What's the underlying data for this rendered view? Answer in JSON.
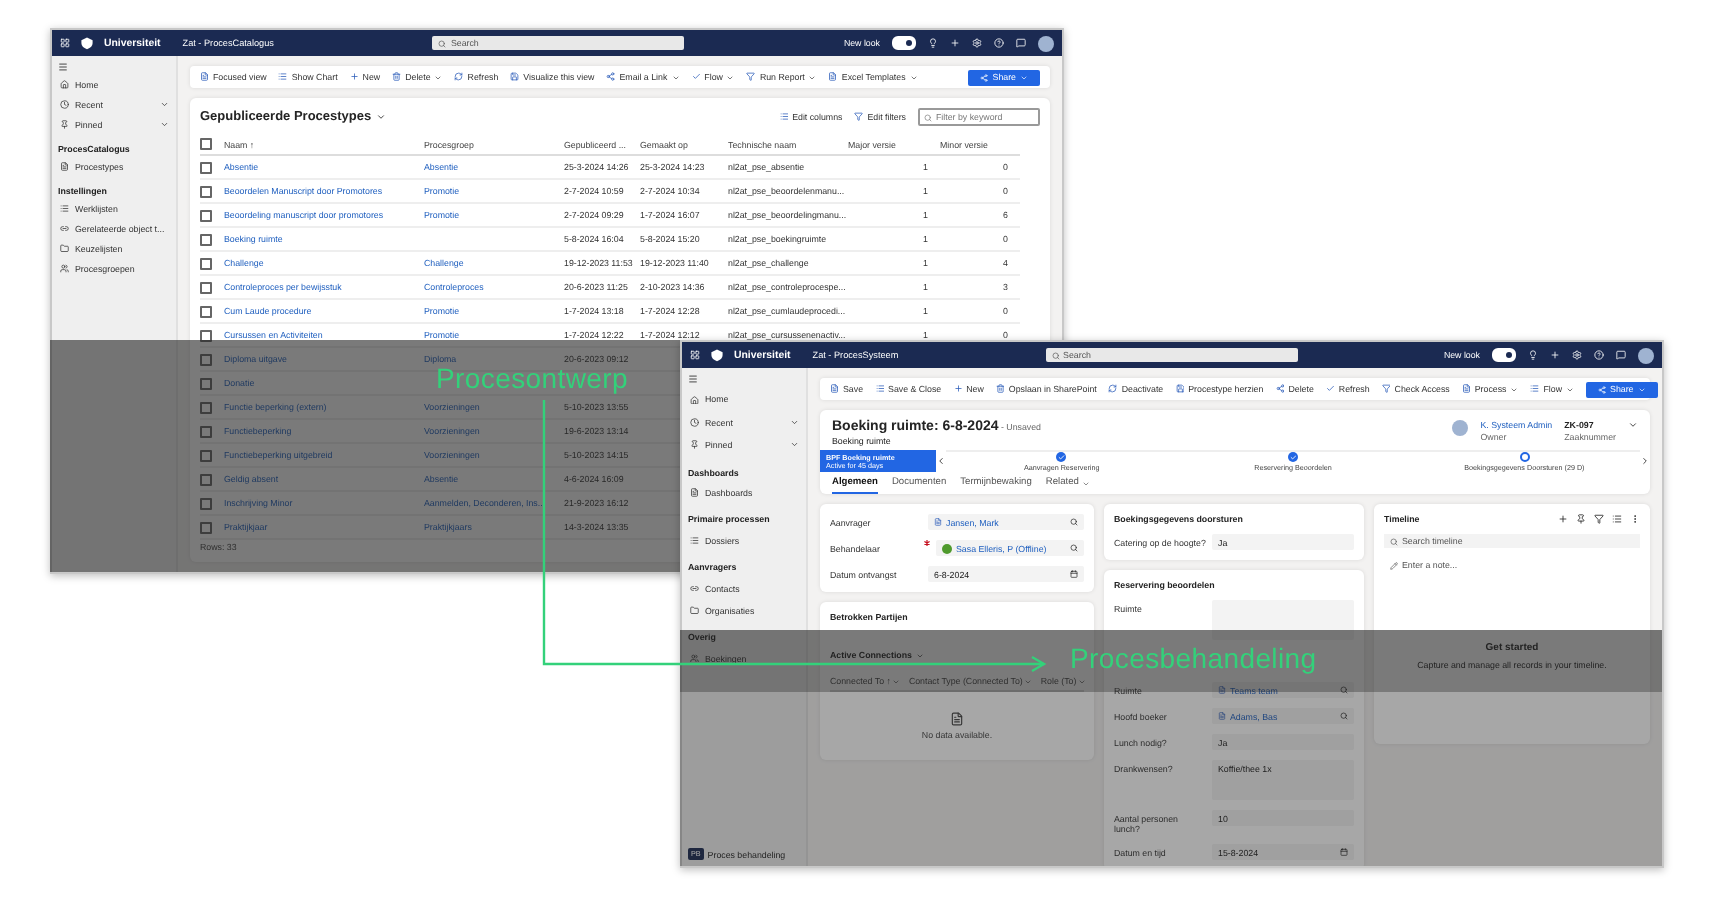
{
  "catalog_window": {
    "nav": {
      "app_title": "Zat - ProcesCatalogus",
      "brand": "Universiteit",
      "search_placeholder": "Search",
      "new_look_label": "New look",
      "new_look_on": true
    },
    "sidebar": [
      {
        "kind": "nav",
        "label": "Home"
      },
      {
        "kind": "group",
        "label": "Recent"
      },
      {
        "kind": "group",
        "label": "Pinned"
      },
      {
        "kind": "section",
        "label": "ProcesCatalogus"
      },
      {
        "kind": "item",
        "label": "Procestypes"
      },
      {
        "kind": "section",
        "label": "Instellingen"
      },
      {
        "kind": "item",
        "label": "Werklijsten"
      },
      {
        "kind": "item",
        "label": "Gerelateerde object t..."
      },
      {
        "kind": "item",
        "label": "Keuzelijsten"
      },
      {
        "kind": "item",
        "label": "Procesgroepen"
      }
    ],
    "commands": [
      {
        "label": "Focused view",
        "menu": false
      },
      {
        "label": "Show Chart",
        "menu": false
      },
      {
        "label": "New",
        "menu": false
      },
      {
        "label": "Delete",
        "menu": true
      },
      {
        "label": "Refresh",
        "menu": false
      },
      {
        "label": "Visualize this view",
        "menu": false
      },
      {
        "label": "Email a Link",
        "menu": true
      },
      {
        "label": "Flow",
        "menu": true
      },
      {
        "label": "Run Report",
        "menu": true
      },
      {
        "label": "Excel Templates",
        "menu": true
      }
    ],
    "share": "Share",
    "view_title": "Gepubliceerde Procestypes",
    "view_actions": [
      "Edit columns",
      "Edit filters"
    ],
    "filter_placeholder": "Filter by keyword",
    "select_all_checked": false,
    "columns": [
      "Naam ↑",
      "Procesgroep",
      "Gepubliceerd ...",
      "Gemaakt op",
      "Technische naam",
      "Major versie",
      "Minor versie"
    ],
    "rows": [
      {
        "checked": false,
        "cells": [
          "Absentie",
          "Absentie",
          "25-3-2024 14:26",
          "25-3-2024 14:23",
          "nl2at_pse_absentie",
          "1",
          "0"
        ]
      },
      {
        "checked": false,
        "cells": [
          "Beoordelen Manuscript door Promotores",
          "Promotie",
          "2-7-2024 10:59",
          "2-7-2024 10:34",
          "nl2at_pse_beoordelenmanu...",
          "1",
          "0"
        ]
      },
      {
        "checked": false,
        "cells": [
          "Beoordeling manuscript door promotores",
          "Promotie",
          "2-7-2024 09:29",
          "1-7-2024 16:07",
          "nl2at_pse_beoordelingmanu...",
          "1",
          "6"
        ]
      },
      {
        "checked": false,
        "cells": [
          "Boeking ruimte",
          "",
          "5-8-2024 16:04",
          "5-8-2024 15:20",
          "nl2at_pse_boekingruimte",
          "1",
          "0"
        ]
      },
      {
        "checked": false,
        "cells": [
          "Challenge",
          "Challenge",
          "19-12-2023 11:53",
          "19-12-2023 11:40",
          "nl2at_pse_challenge",
          "1",
          "4"
        ]
      },
      {
        "checked": false,
        "cells": [
          "Controleproces per bewijsstuk",
          "Controleproces",
          "20-6-2023 11:25",
          "2-10-2023 14:36",
          "nl2at_pse_controleprocespe...",
          "1",
          "3"
        ]
      },
      {
        "checked": false,
        "cells": [
          "Cum Laude procedure",
          "Promotie",
          "1-7-2024 13:18",
          "1-7-2024 12:28",
          "nl2at_pse_cumlaudeprocedi...",
          "1",
          "0"
        ]
      },
      {
        "checked": false,
        "cells": [
          "Cursussen en Activiteiten",
          "Promotie",
          "1-7-2024 12:22",
          "1-7-2024 12:12",
          "nl2at_pse_cursussenenactiv...",
          "1",
          "0"
        ]
      },
      {
        "checked": false,
        "cells": [
          "Diploma uitgave",
          "Diploma",
          "20-6-2023 09:12"
        ]
      },
      {
        "checked": false,
        "cells": [
          "Donatie"
        ]
      },
      {
        "checked": false,
        "cells": [
          "Functie beperking (extern)",
          "Voorzieningen",
          "5-10-2023 13:55"
        ]
      },
      {
        "checked": false,
        "cells": [
          "Functiebeperking",
          "Voorzieningen",
          "19-6-2023 13:14"
        ]
      },
      {
        "checked": false,
        "cells": [
          "Functiebeperking uitgebreid",
          "Voorzieningen",
          "5-10-2023 14:15"
        ]
      },
      {
        "checked": false,
        "cells": [
          "Geldig absent",
          "Absentie",
          "4-6-2024 16:09"
        ]
      },
      {
        "checked": false,
        "cells": [
          "Inschrijving Minor",
          "Aanmelden, Deconderen, Ins...",
          "21-9-2023 16:12"
        ]
      },
      {
        "checked": false,
        "cells": [
          "Praktijkjaar",
          "Praktijkjaars",
          "14-3-2024 13:35"
        ]
      }
    ],
    "footer": "Rows: 33"
  },
  "process_window": {
    "nav": {
      "app_title": "Zat - ProcesSysteem",
      "brand": "Universiteit",
      "search_placeholder": "Search",
      "new_look_label": "New look",
      "new_look_on": true
    },
    "sidebar": [
      {
        "kind": "nav",
        "label": "Home"
      },
      {
        "kind": "group",
        "label": "Recent"
      },
      {
        "kind": "group",
        "label": "Pinned"
      },
      {
        "kind": "section",
        "label": "Dashboards"
      },
      {
        "kind": "item",
        "label": "Dashboards"
      },
      {
        "kind": "section",
        "label": "Primaire processen"
      },
      {
        "kind": "item",
        "label": "Dossiers"
      },
      {
        "kind": "section",
        "label": "Aanvragers"
      },
      {
        "kind": "item",
        "label": "Contacts"
      },
      {
        "kind": "item",
        "label": "Organisaties"
      },
      {
        "kind": "section",
        "label": "Overig"
      },
      {
        "kind": "item",
        "label": "Boekingen"
      }
    ],
    "area_badge": "PB",
    "area_label": "Proces behandeling",
    "commands": [
      {
        "label": "Save",
        "menu": false
      },
      {
        "label": "Save & Close",
        "menu": false
      },
      {
        "label": "New",
        "menu": false
      },
      {
        "label": "Opslaan in SharePoint",
        "menu": false
      },
      {
        "label": "Deactivate",
        "menu": false
      },
      {
        "label": "Procestype herzien",
        "menu": false
      },
      {
        "label": "Delete",
        "menu": false
      },
      {
        "label": "Refresh",
        "menu": false
      },
      {
        "label": "Check Access",
        "menu": false
      },
      {
        "label": "Process",
        "menu": true
      },
      {
        "label": "Flow",
        "menu": true
      }
    ],
    "share": "Share",
    "record_title": "Boeking ruimte: 6-8-2024",
    "record_status": "- Unsaved",
    "record_type": "Boeking ruimte",
    "owner_name": "K. Systeem Admin",
    "owner_role": "Owner",
    "case_number": "ZK-097",
    "case_label": "Zaaknummer",
    "bpf": {
      "name": "BPF Boeking ruimte",
      "age": "Active for 45 days",
      "stages": [
        {
          "label": "Aanvragen Reservering",
          "completed": true
        },
        {
          "label": "Reservering Beoordelen",
          "completed": true
        },
        {
          "label": "Boekingsgegevens Doorsturen (29 D)",
          "completed": false
        }
      ]
    },
    "tabs": [
      {
        "label": "Algemeen",
        "selected": true
      },
      {
        "label": "Documenten",
        "selected": false
      },
      {
        "label": "Termijnbewaking",
        "selected": false
      },
      {
        "label": "Related",
        "selected": false
      }
    ],
    "main_fields": [
      {
        "kind": "lookup",
        "label": "Aanvrager",
        "value": "Jansen, Mark",
        "required": false
      },
      {
        "kind": "person",
        "label": "Behandelaar",
        "value": "Sasa Elleris, P (Offline)",
        "required": true
      },
      {
        "kind": "date",
        "label": "Datum ontvangst",
        "value": "6-8-2024",
        "required": false
      }
    ],
    "parties": {
      "title": "Betrokken Partijen",
      "view": "Active Connections",
      "columns": [
        "Connected To ↑",
        "Contact Type (Connected To)",
        "Role (To)"
      ],
      "empty": "No data available."
    },
    "sections": [
      {
        "title": "Boekingsgegevens doorsturen",
        "fields": [
          {
            "kind": "text",
            "label": "Catering op de hoogte?",
            "value": "Ja",
            "required": false
          }
        ]
      },
      {
        "title": "Reservering beoordelen",
        "fields": [
          {
            "kind": "multiline",
            "label": "Ruimte",
            "required": false
          },
          {
            "kind": "lookup",
            "label": "Ruimte",
            "value": "Teams team",
            "required": false
          },
          {
            "kind": "lookup",
            "label": "Hoofd boeker",
            "value": "Adams, Bas",
            "required": false
          },
          {
            "kind": "text",
            "label": "Lunch nodig?",
            "value": "Ja",
            "required": false
          },
          {
            "kind": "multiline",
            "label": "Drankwensen?",
            "value": "Koffie/thee 1x",
            "required": false
          },
          {
            "kind": "text",
            "label": "Aantal personen lunch?",
            "value": "10",
            "required": false
          },
          {
            "kind": "date",
            "label": "Datum en tijd",
            "value": "15-8-2024",
            "required": false
          }
        ]
      }
    ],
    "timeline": {
      "title": "Timeline",
      "search_placeholder": "Search timeline",
      "note_placeholder": "Enter a note...",
      "empty_title": "Get started",
      "empty_text": "Capture and manage all records in your timeline."
    }
  },
  "labels": {
    "design": "Procesontwerp",
    "handling": "Procesbehandeling"
  }
}
